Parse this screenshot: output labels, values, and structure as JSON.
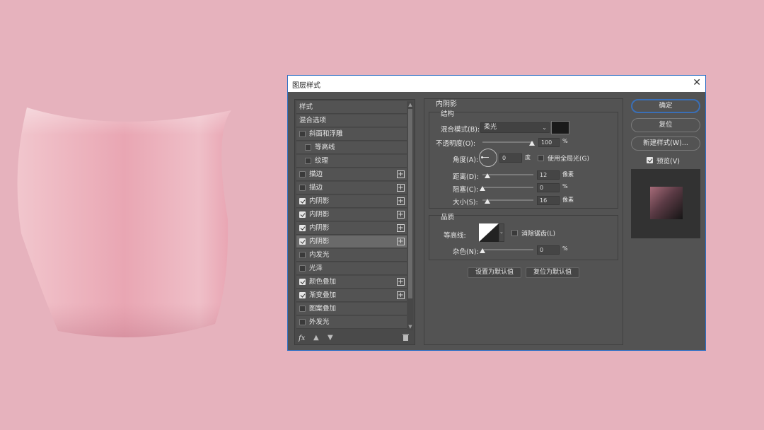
{
  "colors": {
    "canvas_bg": "#e6b2bd",
    "dialog_bg": "#535353",
    "accent": "#2d6fc4",
    "shadow_color": "#1a1a1a"
  },
  "dialog": {
    "title": "图层样式",
    "close_icon": "close-icon"
  },
  "styles_list": {
    "header": "样式",
    "items": [
      {
        "label": "混合选项"
      },
      {
        "label": "斜面和浮雕",
        "checked": false
      },
      {
        "label": "等高线",
        "checked": false
      },
      {
        "label": "纹理",
        "checked": false
      },
      {
        "label": "描边",
        "checked": false
      },
      {
        "label": "描边",
        "checked": false
      },
      {
        "label": "内阴影",
        "checked": true
      },
      {
        "label": "内阴影",
        "checked": true
      },
      {
        "label": "内阴影",
        "checked": true
      },
      {
        "label": "内阴影",
        "checked": true,
        "selected": true
      },
      {
        "label": "内发光",
        "checked": false
      },
      {
        "label": "光泽",
        "checked": false
      },
      {
        "label": "颜色叠加",
        "checked": true
      },
      {
        "label": "渐变叠加",
        "checked": true
      },
      {
        "label": "图案叠加",
        "checked": false
      },
      {
        "label": "外发光",
        "checked": false
      }
    ],
    "footer": {
      "fx": "fx",
      "up_icon": "arrow-up-icon",
      "down_icon": "arrow-down-icon",
      "trash_icon": "trash-icon"
    }
  },
  "panel": {
    "title": "内阴影",
    "structure": {
      "title": "结构",
      "blend_mode_label": "混合模式(B):",
      "blend_mode_value": "柔光",
      "opacity_label": "不透明度(O):",
      "opacity_value": "100",
      "opacity_unit": "%",
      "angle_label": "角度(A):",
      "angle_value": "0",
      "angle_unit": "度",
      "global_light_label": "使用全局光(G)",
      "global_light_checked": false,
      "distance_label": "距离(D):",
      "distance_value": "12",
      "distance_unit": "像素",
      "choke_label": "阻塞(C):",
      "choke_value": "0",
      "choke_unit": "%",
      "size_label": "大小(S):",
      "size_value": "16",
      "size_unit": "像素"
    },
    "quality": {
      "title": "品质",
      "contour_label": "等高线:",
      "antialias_label": "消除锯齿(L)",
      "antialias_checked": false,
      "noise_label": "杂色(N):",
      "noise_value": "0",
      "noise_unit": "%"
    },
    "set_default": "设置为默认值",
    "reset_default": "复位为默认值"
  },
  "actions": {
    "ok": "确定",
    "reset": "复位",
    "new_style": "新建样式(W)...",
    "preview_label": "预览(V)",
    "preview_checked": true
  }
}
